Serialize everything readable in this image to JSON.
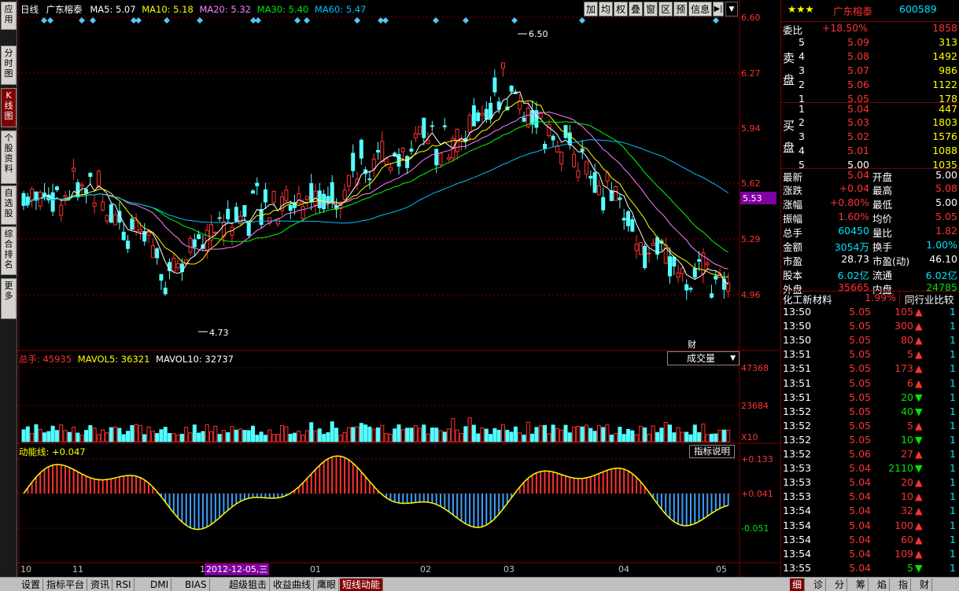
{
  "left_tabs": [
    "应用",
    "分时图",
    "K线图",
    "个股资料",
    "自选股",
    "综合排名",
    "更多"
  ],
  "ma_line": {
    "period": "日线",
    "name": "广东榕泰",
    "ma5": "MA5: 5.07",
    "ma10": "MA10: 5.18",
    "ma20": "MA20: 5.32",
    "ma30": "MA30: 5.40",
    "ma60": "MA60: 5.47"
  },
  "toolbar": [
    "加",
    "均",
    "权",
    "叠",
    "窗",
    "区",
    "预",
    "信息"
  ],
  "price_axis": [
    "6.60",
    "6.27",
    "5.94",
    "5.62",
    "5.29",
    "4.96"
  ],
  "current_price_tag": "5.53",
  "high_label": "6.50",
  "low_label": "4.73",
  "cai_label": "财",
  "volume": {
    "title": "总手: 45935",
    "mavol5": "MAVOL5: 36321",
    "mavol10": "MAVOL10: 32737",
    "axis": [
      "47368",
      "23684",
      "X10"
    ],
    "dropdown": "成交量"
  },
  "indicator": {
    "title": "动能线: +0.047",
    "button": "指标说明",
    "axis": [
      "+0.133",
      "+0.041",
      "-0.051"
    ]
  },
  "x_labels": [
    "10",
    "11",
    "12",
    "01",
    "02",
    "03",
    "04",
    "05"
  ],
  "date_box": "2012-12-05,三",
  "colors": {
    "up": "#ff3232",
    "down": "#54ffff",
    "ma5": "#ffffff",
    "ma10": "#ffff00",
    "ma20": "#ff80ff",
    "ma30": "#00ff00",
    "ma60": "#00c0ff",
    "grid": "#800000"
  },
  "chart_data": {
    "type": "candlestick",
    "price_ylim": [
      4.73,
      6.5
    ],
    "high": 6.5,
    "low": 4.73,
    "last_close": 5.04
  },
  "stock": {
    "name": "广东榕泰",
    "code": "600589",
    "stars": "★★★"
  },
  "weibi": {
    "label": "委比",
    "pct": "+18.50%",
    "diff": "1858"
  },
  "sell": [
    {
      "n": "5",
      "p": "5.09",
      "v": "313"
    },
    {
      "n": "4",
      "p": "5.08",
      "v": "1492"
    },
    {
      "n": "3",
      "p": "5.07",
      "v": "986"
    },
    {
      "n": "2",
      "p": "5.06",
      "v": "1122"
    },
    {
      "n": "1",
      "p": "5.05",
      "v": "178"
    }
  ],
  "buy": [
    {
      "n": "1",
      "p": "5.04",
      "v": "447"
    },
    {
      "n": "2",
      "p": "5.03",
      "v": "1803"
    },
    {
      "n": "3",
      "p": "5.02",
      "v": "1576"
    },
    {
      "n": "4",
      "p": "5.01",
      "v": "1088"
    },
    {
      "n": "5",
      "p": "5.00",
      "v": "1035"
    }
  ],
  "sell_label": "卖盘",
  "buy_label": "买盘",
  "quote": [
    {
      "l1": "最新",
      "v1": "5.04",
      "l2": "开盘",
      "v2": "5.00"
    },
    {
      "l1": "涨跌",
      "v1": "+0.04",
      "l2": "最高",
      "v2": "5.08"
    },
    {
      "l1": "涨幅",
      "v1": "+0.80%",
      "l2": "最低",
      "v2": "5.00"
    },
    {
      "l1": "振幅",
      "v1": "1.60%",
      "l2": "均价",
      "v2": "5.05"
    },
    {
      "l1": "总手",
      "v1": "60450",
      "l2": "量比",
      "v2": "1.82"
    },
    {
      "l1": "金额",
      "v1": "3054万",
      "l2": "换手",
      "v2": "1.00%"
    },
    {
      "l1": "市盈",
      "v1": "28.73",
      "l2": "市盈(动)",
      "v2": "46.10"
    },
    {
      "l1": "股本",
      "v1": "6.02亿",
      "l2": "流通",
      "v2": "6.02亿"
    },
    {
      "l1": "外盘",
      "v1": "35665",
      "l2": "内盘",
      "v2": "24785"
    }
  ],
  "sector": {
    "name": "化工新材料",
    "pct": "1.99%",
    "button": "同行业比较"
  },
  "ticks": [
    {
      "t": "13:50",
      "p": "5.05",
      "v": "105",
      "d": "up"
    },
    {
      "t": "13:50",
      "p": "5.05",
      "v": "300",
      "d": "up"
    },
    {
      "t": "13:50",
      "p": "5.05",
      "v": "80",
      "d": "up"
    },
    {
      "t": "13:51",
      "p": "5.05",
      "v": "5",
      "d": "up"
    },
    {
      "t": "13:51",
      "p": "5.05",
      "v": "173",
      "d": "up"
    },
    {
      "t": "13:51",
      "p": "5.05",
      "v": "6",
      "d": "up"
    },
    {
      "t": "13:51",
      "p": "5.05",
      "v": "20",
      "d": "down"
    },
    {
      "t": "13:52",
      "p": "5.05",
      "v": "40",
      "d": "down"
    },
    {
      "t": "13:52",
      "p": "5.05",
      "v": "5",
      "d": "up"
    },
    {
      "t": "13:52",
      "p": "5.05",
      "v": "10",
      "d": "down"
    },
    {
      "t": "13:52",
      "p": "5.06",
      "v": "27",
      "d": "up"
    },
    {
      "t": "13:53",
      "p": "5.04",
      "v": "2110",
      "d": "down"
    },
    {
      "t": "13:53",
      "p": "5.04",
      "v": "20",
      "d": "up"
    },
    {
      "t": "13:53",
      "p": "5.04",
      "v": "10",
      "d": "up"
    },
    {
      "t": "13:54",
      "p": "5.04",
      "v": "32",
      "d": "up"
    },
    {
      "t": "13:54",
      "p": "5.04",
      "v": "100",
      "d": "up"
    },
    {
      "t": "13:54",
      "p": "5.04",
      "v": "60",
      "d": "up"
    },
    {
      "t": "13:54",
      "p": "5.04",
      "v": "109",
      "d": "up"
    },
    {
      "t": "13:55",
      "p": "5.04",
      "v": "5",
      "d": "down"
    }
  ],
  "tick_count": "1",
  "bottom_tabs": [
    "设置",
    "指标平台",
    "资讯",
    "RSI",
    "DMI",
    "BIAS",
    "超级狙击",
    "收益曲线",
    "鹰眼",
    "短线动能"
  ],
  "right_bottom_tabs": [
    "细",
    "诊",
    "分",
    "筹",
    "焰",
    "指",
    "财"
  ]
}
